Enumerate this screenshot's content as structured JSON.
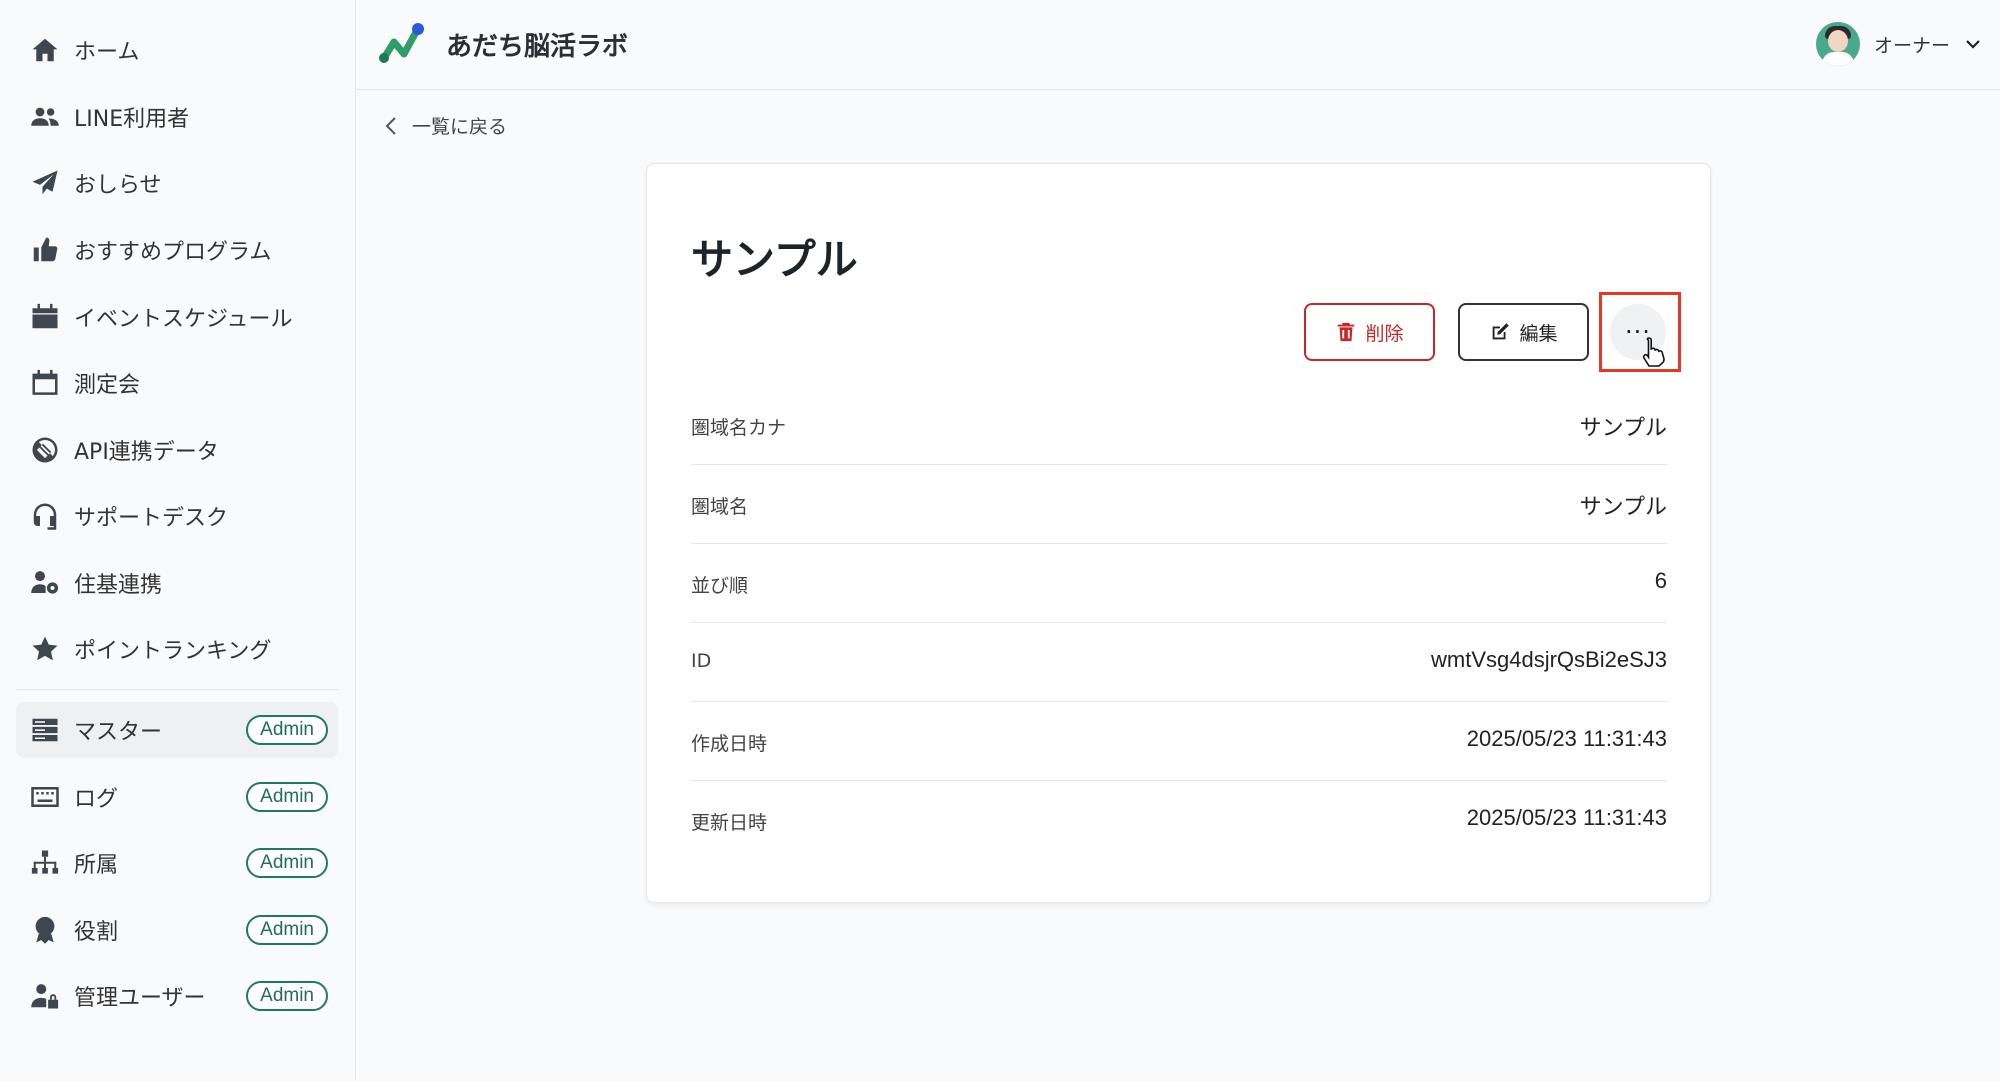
{
  "app": {
    "title": "あだち脳活ラボ"
  },
  "user": {
    "name": "オーナー"
  },
  "sidebar": {
    "items": [
      {
        "label": "ホーム",
        "icon": "home-icon"
      },
      {
        "label": "LINE利用者",
        "icon": "users-icon"
      },
      {
        "label": "おしらせ",
        "icon": "paper-plane-icon"
      },
      {
        "label": "おすすめプログラム",
        "icon": "thumbs-up-icon"
      },
      {
        "label": "イベントスケジュール",
        "icon": "calendar-icon"
      },
      {
        "label": "測定会",
        "icon": "calendar-outline-icon"
      },
      {
        "label": "API連携データ",
        "icon": "plug-icon"
      },
      {
        "label": "サポートデスク",
        "icon": "headset-icon"
      },
      {
        "label": "住基連携",
        "icon": "user-gear-icon"
      },
      {
        "label": "ポイントランキング",
        "icon": "star-icon"
      }
    ],
    "admin_items": [
      {
        "label": "マスター",
        "badge": "Admin",
        "icon": "server-icon",
        "active": true
      },
      {
        "label": "ログ",
        "badge": "Admin",
        "icon": "keyboard-icon"
      },
      {
        "label": "所属",
        "badge": "Admin",
        "icon": "sitemap-icon"
      },
      {
        "label": "役割",
        "badge": "Admin",
        "icon": "award-icon"
      },
      {
        "label": "管理ユーザー",
        "badge": "Admin",
        "icon": "user-lock-icon"
      }
    ]
  },
  "back": {
    "label": "一覧に戻る"
  },
  "detail": {
    "title": "サンプル",
    "delete_label": "削除",
    "edit_label": "編集",
    "more_label": "···",
    "rows": [
      {
        "label": "圏域名カナ",
        "value": "サンプル"
      },
      {
        "label": "圏域名",
        "value": "サンプル"
      },
      {
        "label": "並び順",
        "value": "6"
      },
      {
        "label": "ID",
        "value": "wmtVsg4dsjrQsBi2eSJ3"
      },
      {
        "label": "作成日時",
        "value": "2025/05/23 11:31:43"
      },
      {
        "label": "更新日時",
        "value": "2025/05/23 11:31:43"
      }
    ]
  },
  "colors": {
    "accent": "#1f7a63",
    "danger": "#c62828",
    "highlight": "#e53925"
  }
}
